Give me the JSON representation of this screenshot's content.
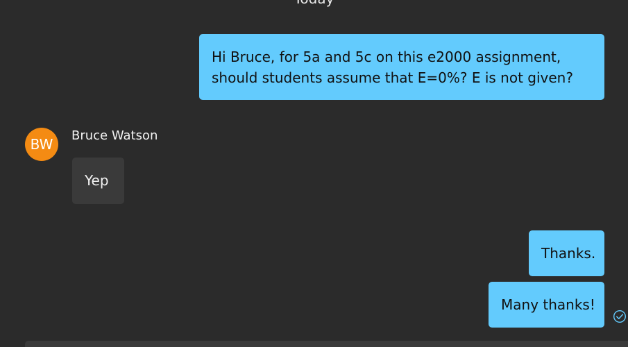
{
  "conversation": {
    "date_divider": "Today"
  },
  "messages": [
    {
      "direction": "outgoing",
      "text": "Hi Bruce, for 5a and 5c on this e2000 assignment, should students assume that E=0%? E is not given?"
    },
    {
      "direction": "incoming",
      "sender": "Bruce Watson",
      "avatar_initials": "BW",
      "avatar_color": "#f48b13",
      "text": "Yep"
    },
    {
      "direction": "outgoing",
      "text": "Thanks."
    },
    {
      "direction": "outgoing",
      "text": "Many thanks!",
      "status_icon": "read-receipt-check-icon"
    }
  ],
  "theme": {
    "background": "#2b2b2b",
    "outgoing_bubble": "#63cbfd",
    "incoming_bubble": "#3a3a3a",
    "receipt_color": "#63cbfd"
  }
}
